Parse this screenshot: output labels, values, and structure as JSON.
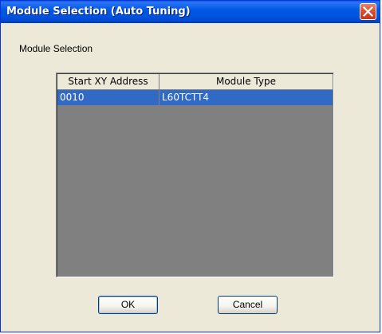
{
  "window": {
    "title": "Module Selection (Auto Tuning)",
    "close_icon": "close-icon"
  },
  "section": {
    "label": "Module Selection"
  },
  "table": {
    "columns": [
      "Start XY Address",
      "Module Type"
    ],
    "rows": [
      [
        "0010",
        "L60TCTT4"
      ]
    ]
  },
  "buttons": {
    "ok_label": "OK",
    "cancel_label": "Cancel"
  },
  "colors": {
    "title_bar": "#0058e6",
    "selection": "#316ac5",
    "grid_background": "#808080",
    "dialog_face": "#ece9d8"
  }
}
